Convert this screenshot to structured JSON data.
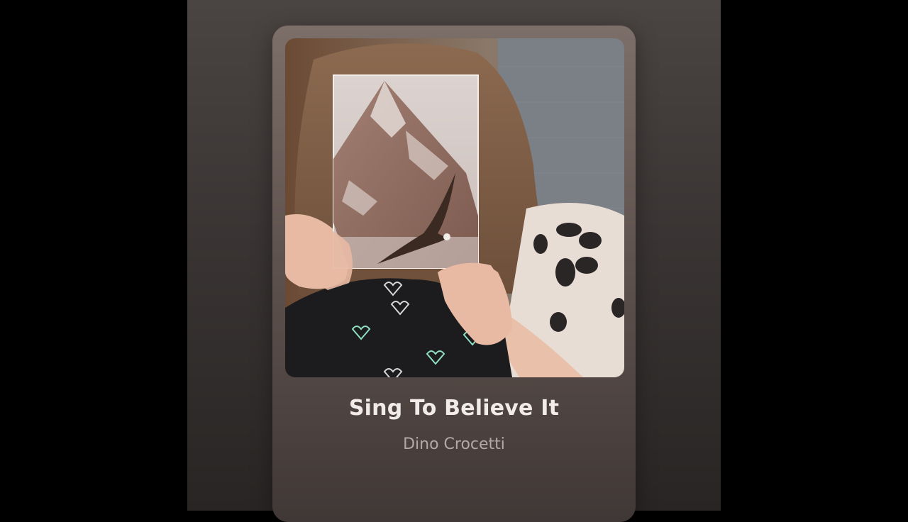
{
  "track": {
    "title": "Sing To Believe It",
    "artist": "Dino Crocetti"
  },
  "artwork": {
    "description_icon": "album-art-image"
  },
  "colors": {
    "page_background": "#000000",
    "panel_top": "#4a4442",
    "card_top": "#7c6e68",
    "title_text": "#f1ece9",
    "artist_text": "#b3a9a4"
  }
}
